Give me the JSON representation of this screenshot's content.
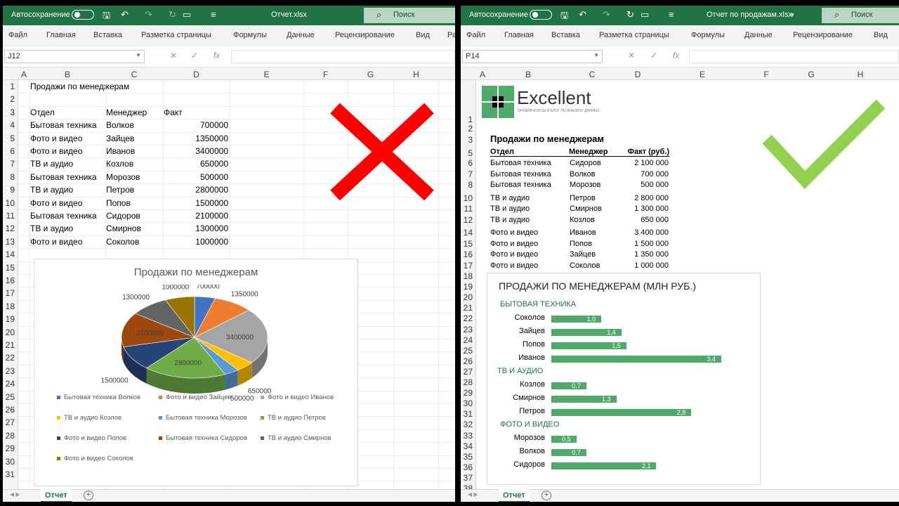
{
  "left": {
    "autosave_label": "Автосохранение",
    "doc_title": "Отчет.xlsx",
    "search_label": "Поиск",
    "ribbon": [
      "Файл",
      "Главная",
      "Вставка",
      "Разметка страницы",
      "Формулы",
      "Данные",
      "Рецензирование",
      "Вид",
      "Ра"
    ],
    "namebox": "J12",
    "columns": [
      "A",
      "B",
      "C",
      "D",
      "E",
      "F",
      "G",
      "H"
    ],
    "rows": [
      "1",
      "2",
      "3",
      "4",
      "5",
      "6",
      "7",
      "8",
      "9",
      "10",
      "11",
      "12",
      "13",
      "14",
      "15",
      "16",
      "17",
      "18",
      "19",
      "20",
      "21",
      "22",
      "23",
      "24",
      "25",
      "26",
      "27",
      "28",
      "29",
      "30",
      "31"
    ],
    "sheet_title": "Продажи по менеджерам",
    "headers": [
      "Отдел",
      "Менеджер",
      "Факт"
    ],
    "table": [
      [
        "Бытовая техника",
        "Волков",
        "700000"
      ],
      [
        "Фото и видео",
        "Зайцев",
        "1350000"
      ],
      [
        "Фото и видео",
        "Иванов",
        "3400000"
      ],
      [
        "ТВ и аудио",
        "Козлов",
        "650000"
      ],
      [
        "Бытовая техника",
        "Морозов",
        "500000"
      ],
      [
        "ТВ и аудио",
        "Петров",
        "2800000"
      ],
      [
        "Фото и видео",
        "Попов",
        "1500000"
      ],
      [
        "Бытовая техника",
        "Сидоров",
        "2100000"
      ],
      [
        "ТВ и аудио",
        "Смирнов",
        "1300000"
      ],
      [
        "Фото и видео",
        "Соколов",
        "1000000"
      ]
    ],
    "sheet_tab": "Отчет",
    "add_sheet": "+",
    "mark_color": "#ff0000"
  },
  "right": {
    "autosave_label": "Автосохранение",
    "doc_title": "Отчет по продажам.xlsx",
    "search_label": "Поиск",
    "ribbon": [
      "Файл",
      "Главная",
      "Вставка",
      "Разметка страницы",
      "Формулы",
      "Данные",
      "Рецензирование",
      "Вид"
    ],
    "namebox": "P14",
    "columns": [
      "A",
      "B",
      "C",
      "D",
      "E",
      "F",
      "G",
      "H"
    ],
    "logo_text": "Excellent",
    "logo_tagline": "ОНЛАЙН-КУРСЫ И БЛОГ ПО АНАЛИЗУ ДАННЫХ",
    "sheet_title": "Продажи по менеджерам",
    "headers": [
      "Отдел",
      "Менеджер",
      "Факт (руб.)"
    ],
    "groups": [
      {
        "rows": [
          [
            "Бытовая техника",
            "Сидоров",
            "2 100 000"
          ],
          [
            "Бытовая техника",
            "Волков",
            "700 000"
          ],
          [
            "Бытовая техника",
            "Морозов",
            "500 000"
          ]
        ]
      },
      {
        "rows": [
          [
            "ТВ и аудио",
            "Петров",
            "2 800 000"
          ],
          [
            "ТВ и аудио",
            "Смирнов",
            "1 300 000"
          ],
          [
            "ТВ и аудио",
            "Козлов",
            "650 000"
          ]
        ]
      },
      {
        "rows": [
          [
            "Фото и видео",
            "Иванов",
            "3 400 000"
          ],
          [
            "Фото и видео",
            "Попов",
            "1 500 000"
          ],
          [
            "Фото и видео",
            "Зайцев",
            "1 350 000"
          ],
          [
            "Фото и видео",
            "Соколов",
            "1 000 000"
          ]
        ]
      }
    ],
    "sheet_tab": "Отчет",
    "add_sheet": "+",
    "mark_color": "#92d050"
  },
  "chart_data": [
    {
      "type": "pie",
      "title": "Продажи по менеджерам",
      "categories": [
        "Бытовая техника Волков",
        "Фото и видео Зайцев",
        "Фото и видео Иванов",
        "ТВ и аудио Козлов",
        "Бытовая техника Морозов",
        "ТВ и аудио Петров",
        "Фото и видео Попов",
        "Бытовая техника Сидоров",
        "ТВ и аудио Смирнов",
        "Фото и видео Соколов"
      ],
      "values": [
        700000,
        1350000,
        3400000,
        650000,
        500000,
        2800000,
        1500000,
        2100000,
        1300000,
        1000000
      ],
      "data_labels": [
        "700000",
        "1350000",
        "3400000",
        "650000",
        "500000",
        "2800000",
        "1500000",
        "2100000",
        "1300000",
        "1000000"
      ],
      "colors": [
        "#4472c4",
        "#ed7d31",
        "#a5a5a5",
        "#ffc000",
        "#5b9bd5",
        "#70ad47",
        "#264478",
        "#9e480e",
        "#636363",
        "#997300"
      ],
      "legend": "bottom"
    },
    {
      "type": "bar",
      "title": "ПРОДАЖИ ПО МЕНЕДЖЕРАМ (МЛН РУБ.)",
      "groups": [
        {
          "name": "Бытовая техника",
          "categories": [
            "Соколов",
            "Зайцев",
            "Попов",
            "Иванов"
          ],
          "values": [
            1.0,
            1.4,
            1.5,
            3.4
          ],
          "labels": [
            "1,0",
            "1,4",
            "1,5",
            "3,4"
          ]
        },
        {
          "name": "ТВ и аудио",
          "categories": [
            "Козлов",
            "Смирнов",
            "Петров"
          ],
          "values": [
            0.7,
            1.3,
            2.8
          ],
          "labels": [
            "0,7",
            "1,3",
            "2,8"
          ]
        },
        {
          "name": "Фото и видео",
          "categories": [
            "Морозов",
            "Волков",
            "Сидоров"
          ],
          "values": [
            0.5,
            0.7,
            2.1
          ],
          "labels": [
            "0,5",
            "0,7",
            "2,1"
          ]
        }
      ],
      "color": "#4ea96a"
    }
  ]
}
